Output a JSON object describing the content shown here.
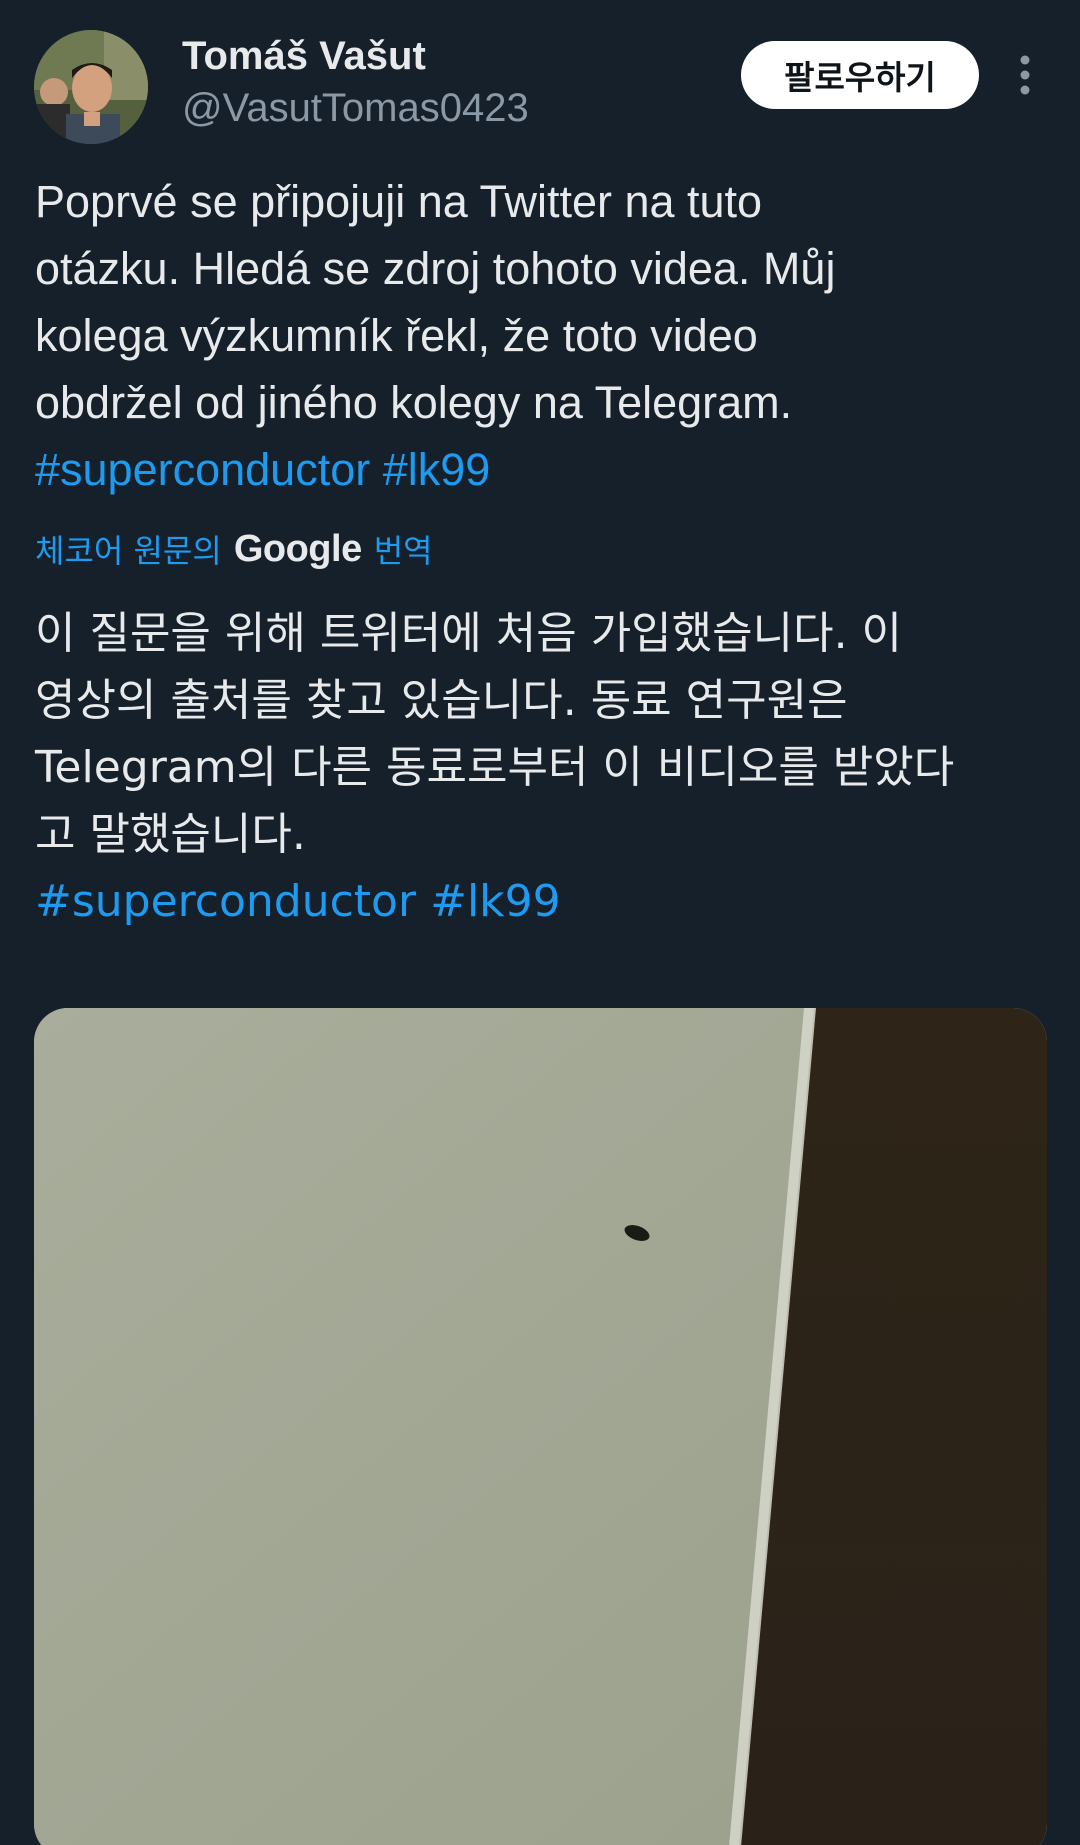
{
  "author": {
    "name": "Tomáš Vašut",
    "handle": "@VasutTomas0423"
  },
  "header": {
    "follow_label": "팔로우하기",
    "more_icon": "more-vertical-icon"
  },
  "tweet": {
    "text_lines": [
      "Poprvé se připojuji na Twitter na tuto",
      "otázku. Hledá se zdroj tohoto videa. Můj",
      "kolega výzkumník řekl, že toto video",
      "obdržel od jiného kolegy na Telegram."
    ],
    "hashtags": [
      "#superconductor",
      "#lk99"
    ]
  },
  "translation": {
    "prefix": "체코어 원문의",
    "provider": "Google",
    "suffix": "번역",
    "text_lines": [
      "이 질문을 위해 트위터에 처음 가입했습니다. 이",
      "영상의 출처를 찾고 있습니다. 동료 연구원은",
      "Telegram의 다른 동료로부터 이 비디오를 받았다",
      "고 말했습니다."
    ],
    "hashtags": [
      "#superconductor",
      "#lk99"
    ]
  },
  "colors": {
    "background": "#15202b",
    "text": "#e7e9ea",
    "secondary_text": "#8b98a5",
    "link": "#1d9bf0",
    "button_bg": "#ffffff"
  }
}
